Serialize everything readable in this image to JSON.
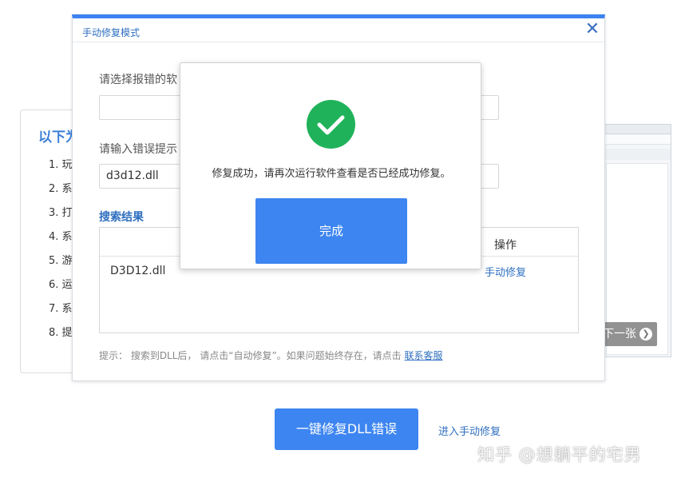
{
  "background": {
    "panel_title": "以下为",
    "list_items": [
      "1. 玩",
      "2. 系",
      "3. 打",
      "4. 系",
      "5. 游",
      "6. 运",
      "7. 系",
      "8. 提"
    ],
    "screenshot_next_label": "下一张",
    "screenshot_next_icon": "chevron-right-icon"
  },
  "dialog": {
    "title": "手动修复模式",
    "close_icon": "close-icon",
    "select_software_label": "请选择报错的软",
    "select_software_value": "",
    "error_input_label": "请输入错误提示",
    "error_input_value": "d3d12.dll",
    "results_title": "搜索结果",
    "results_header_name": "",
    "results_header_action": "操作",
    "results_rows": [
      {
        "name": "D3D12.dll",
        "action": "手动修复"
      }
    ],
    "tip_text": "提示： 搜索到DLL后， 请点击“自动修复”。如果问题始终存在，请点击 ",
    "tip_link": "联系客服"
  },
  "success_modal": {
    "icon": "check-circle-icon",
    "icon_color": "#20b25a",
    "message": "修复成功，请再次运行软件查看是否已经成功修复。",
    "done_label": "完成"
  },
  "bottom": {
    "fix_button_label": "一键修复DLL错误",
    "manual_link": "进入手动修复"
  },
  "watermark": "知乎 @想躺平的宅男",
  "colors": {
    "accent": "#3d85f0",
    "link": "#2f6fbf",
    "success": "#20b25a"
  }
}
